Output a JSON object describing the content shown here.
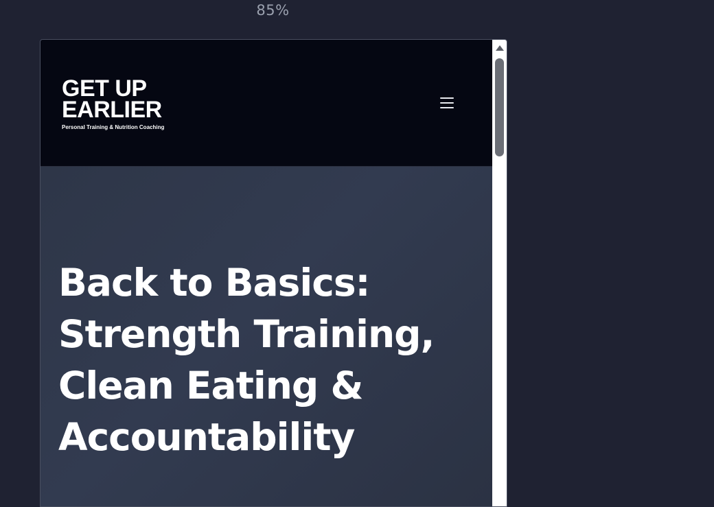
{
  "zoom_level": "85%",
  "site": {
    "logo": {
      "line1": "GET UP",
      "line2": "EARLIER",
      "tagline": "Personal Training & Nutrition Coaching"
    },
    "menu_icon": "hamburger-menu-icon"
  },
  "hero": {
    "title_lines": [
      "Back to Basics:",
      "Strength Training,",
      "Clean Eating &",
      "Accountability"
    ]
  },
  "colors": {
    "page_background": "#1f2232",
    "header_background": "#050712",
    "hero_background": "#2e3648",
    "text": "#ffffff"
  }
}
